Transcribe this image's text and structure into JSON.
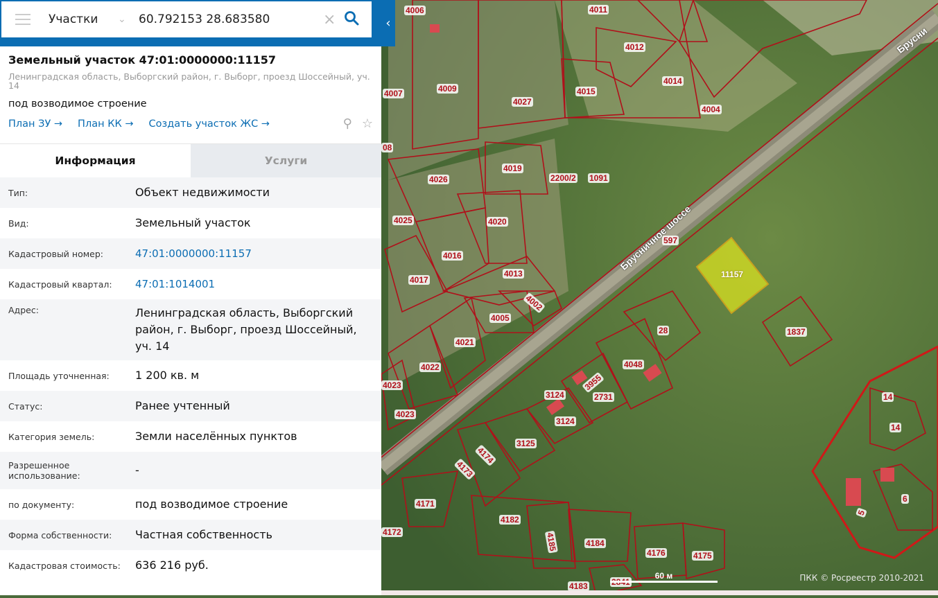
{
  "search": {
    "category": "Участки",
    "query": "60.792153 28.683580"
  },
  "object": {
    "title": "Земельный участок 47:01:0000000:11157",
    "address": "Ленинградская область, Выборгский район, г. Выборг, проезд Шоссейный, уч. 14",
    "purpose": "под возводимое строение",
    "links": [
      "План ЗУ →",
      "План КК →",
      "Создать участок ЖС →"
    ]
  },
  "tabs": [
    {
      "label": "Информация",
      "active": true
    },
    {
      "label": "Услуги",
      "active": false
    }
  ],
  "info": [
    {
      "k": "Тип:",
      "v": "Объект недвижимости"
    },
    {
      "k": "Вид:",
      "v": "Земельный участок"
    },
    {
      "k": "Кадастровый номер:",
      "v": "47:01:0000000:11157"
    },
    {
      "k": "Кадастровый квартал:",
      "v": "47:01:1014001"
    },
    {
      "k": "Адрес:",
      "v": "Ленинградская область, Выборгский район, г. Выборг, проезд Шоссейный, уч. 14"
    },
    {
      "k": "Площадь уточненная:",
      "v": "1 200 кв. м"
    },
    {
      "k": "Статус:",
      "v": "Ранее учтенный"
    },
    {
      "k": "Категория земель:",
      "v": "Земли населённых пунктов"
    },
    {
      "k": "Разрешенное использование:",
      "v": "-"
    },
    {
      "k": "по документу:",
      "v": "под возводимое строение"
    },
    {
      "k": "Форма собственности:",
      "v": "Частная собственность"
    },
    {
      "k": "Кадастровая стоимость:",
      "v": "636 216 руб."
    }
  ],
  "map": {
    "road_label": "Брусничное шоссе",
    "road_label2": "Брусни",
    "selected": "11157",
    "parcels": [
      "4006",
      "4011",
      "4012",
      "4014",
      "4004",
      "4007",
      "4009",
      "4027",
      "4015",
      "4026",
      "4019",
      "2200/2",
      "1091",
      "4025",
      "4020",
      "4016",
      "4017",
      "4013",
      "4002",
      "4005",
      "4021",
      "4022",
      "4023",
      "4023",
      "28",
      "1837",
      "4048",
      "3955",
      "2731",
      "3124",
      "3124",
      "3125",
      "4174",
      "4173",
      "4171",
      "4172",
      "4182",
      "4185",
      "4184",
      "4176",
      "4175",
      "2841",
      "4183",
      "14",
      "14",
      "6",
      "5",
      "597",
      "08"
    ],
    "scale": "60 м",
    "copyright": "ПКК © Росреестр 2010-2021"
  },
  "colors": {
    "accent": "#0b6db3",
    "parcel": "#b0101a",
    "selected": "#d8e020"
  }
}
